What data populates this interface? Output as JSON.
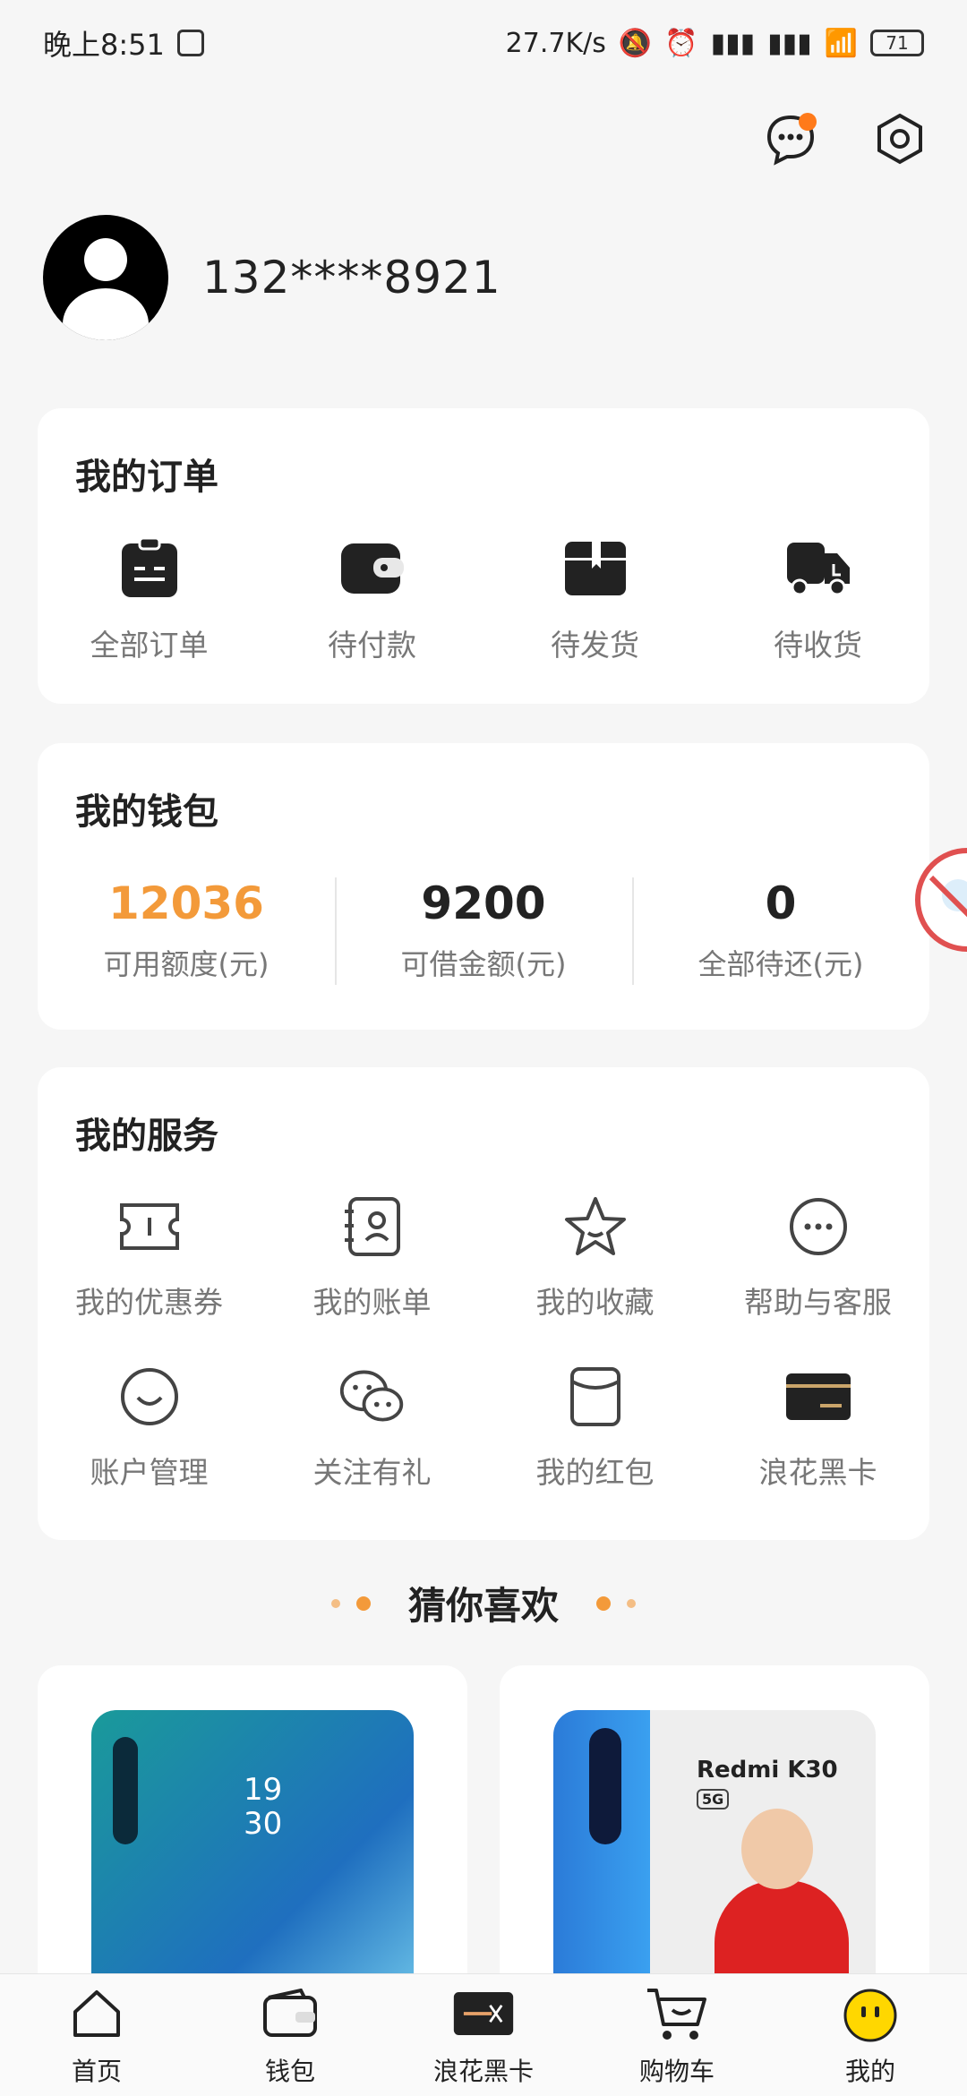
{
  "status_bar": {
    "time": "晚上8:51",
    "net_speed": "27.7K/s",
    "battery": "71"
  },
  "profile": {
    "phone": "132****8921"
  },
  "orders": {
    "title": "我的订单",
    "items": [
      {
        "label": "全部订单",
        "icon": "clipboard-icon"
      },
      {
        "label": "待付款",
        "icon": "wallet-icon"
      },
      {
        "label": "待发货",
        "icon": "box-icon"
      },
      {
        "label": "待收货",
        "icon": "truck-icon"
      }
    ]
  },
  "wallet": {
    "title": "我的钱包",
    "items": [
      {
        "value": "12036",
        "label": "可用额度(元)"
      },
      {
        "value": "9200",
        "label": "可借金额(元)"
      },
      {
        "value": "0",
        "label": "全部待还(元)"
      }
    ]
  },
  "services": {
    "title": "我的服务",
    "items": [
      {
        "label": "我的优惠券",
        "icon": "coupon-icon"
      },
      {
        "label": "我的账单",
        "icon": "bill-icon"
      },
      {
        "label": "我的收藏",
        "icon": "star-icon"
      },
      {
        "label": "帮助与客服",
        "icon": "chat-icon"
      },
      {
        "label": "账户管理",
        "icon": "smile-icon"
      },
      {
        "label": "关注有礼",
        "icon": "wechat-icon"
      },
      {
        "label": "我的红包",
        "icon": "redpacket-icon"
      },
      {
        "label": "浪花黑卡",
        "icon": "blackcard-icon"
      }
    ]
  },
  "recommend": {
    "title": "猜你喜欢"
  },
  "products": [
    {
      "name": "phone-1",
      "screen_text": "19\n30"
    },
    {
      "name": "phone-2",
      "screen_text": "Redmi K30"
    }
  ],
  "tabbar": {
    "items": [
      {
        "label": "首页",
        "icon": "home-icon"
      },
      {
        "label": "钱包",
        "icon": "wallet-icon"
      },
      {
        "label": "浪花黑卡",
        "icon": "blackcard-icon"
      },
      {
        "label": "购物车",
        "icon": "cart-icon"
      },
      {
        "label": "我的",
        "icon": "profile-face-icon"
      }
    ]
  },
  "colors": {
    "accent": "#f39a3a",
    "notification_dot": "#ff7a1a"
  }
}
